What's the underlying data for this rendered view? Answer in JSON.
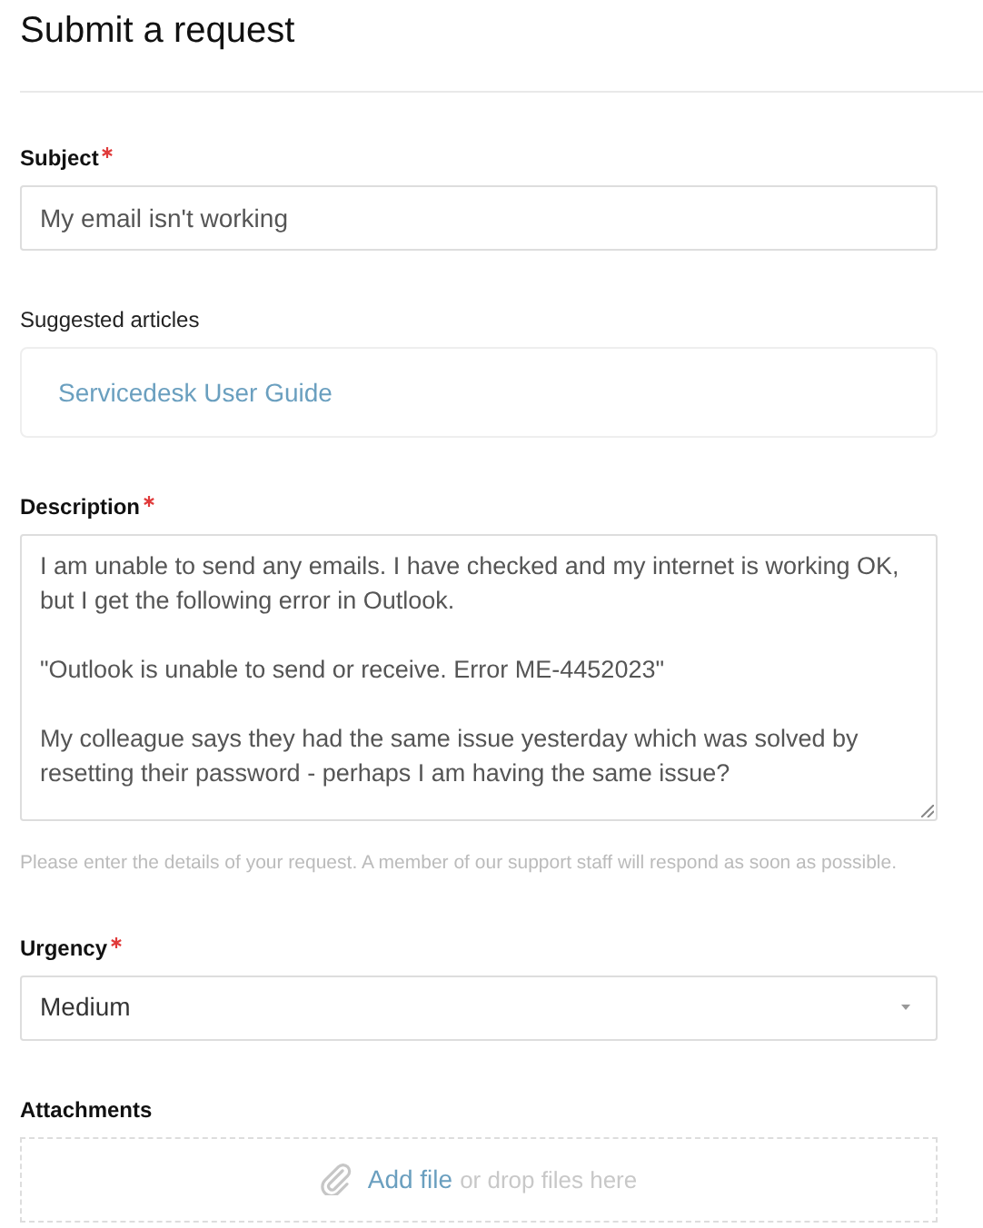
{
  "title": "Submit a request",
  "fields": [
    {
      "kind": "text",
      "label": "Subject",
      "required": true,
      "value": "My email isn't working"
    },
    {
      "kind": "suggestions",
      "label": "Suggested articles",
      "required": false,
      "articles": [
        "Servicedesk User Guide"
      ]
    },
    {
      "kind": "textarea",
      "label": "Description",
      "required": true,
      "value": "I am unable to send any emails. I have checked and my internet is working OK, but I get the following error in Outlook.\n\n\"Outlook is unable to send or receive. Error ME-4452023\"\n\nMy colleague says they had the same issue yesterday which was solved by resetting their password - perhaps I am having the same issue?",
      "hint": "Please enter the details of your request. A member of our support staff will respond as soon as possible."
    },
    {
      "kind": "select",
      "label": "Urgency",
      "required": true,
      "value": "Medium"
    },
    {
      "kind": "attachments",
      "label": "Attachments",
      "required": false,
      "link": "Add file",
      "text": "or drop files here"
    }
  ]
}
